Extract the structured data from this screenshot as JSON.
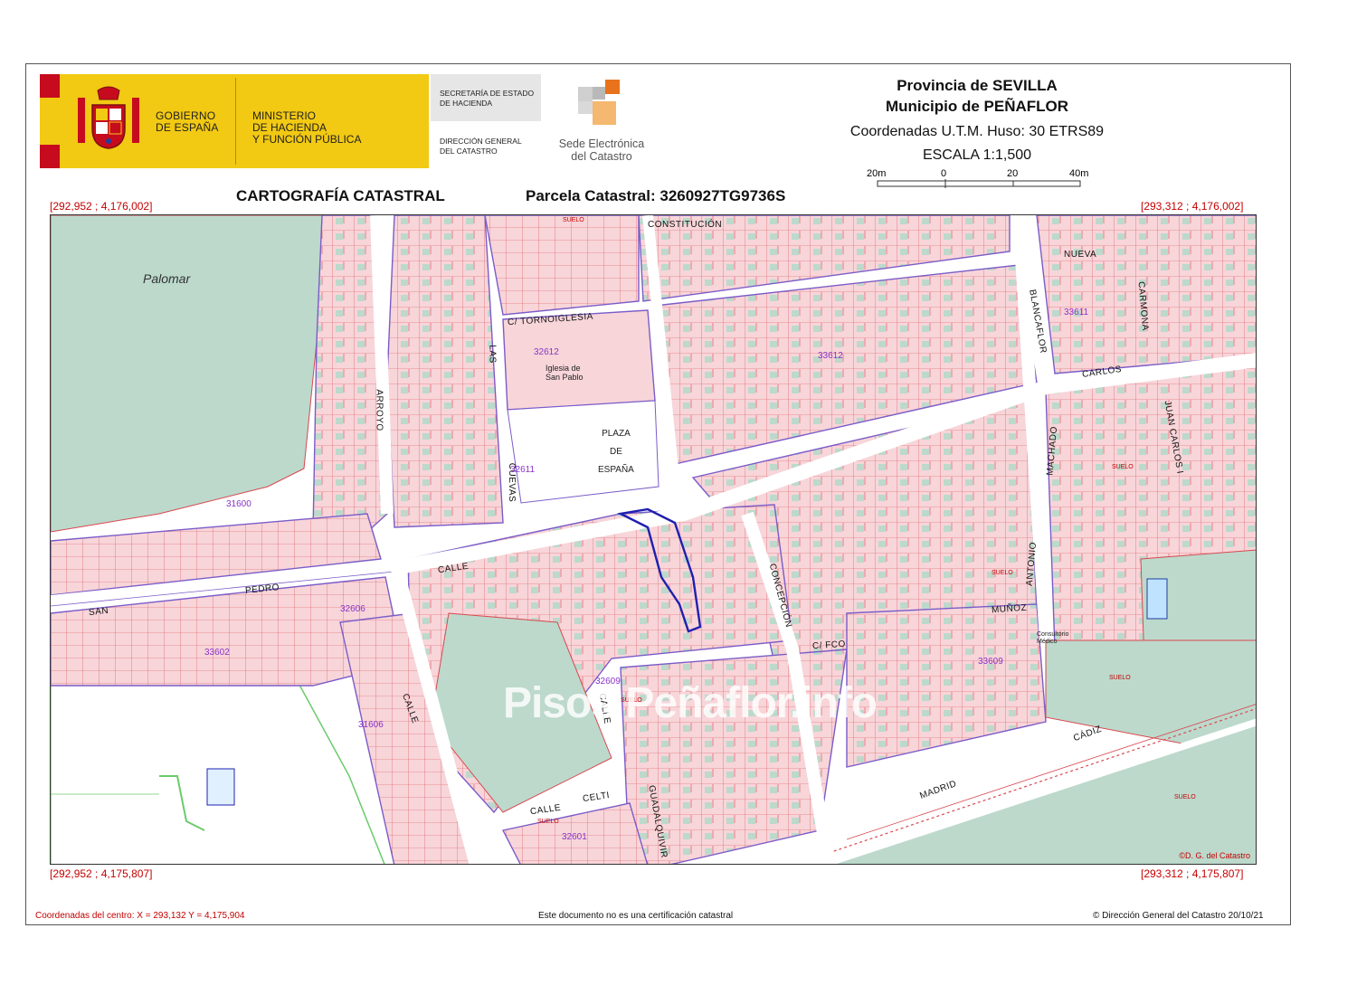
{
  "header": {
    "gobierno_line1": "GOBIERNO",
    "gobierno_line2": "DE ESPAÑA",
    "ministerio_line1": "MINISTERIO",
    "ministerio_line2": "DE HACIENDA",
    "ministerio_line3": "Y FUNCIÓN PÚBLICA",
    "secretaria_line1": "SECRETARÍA DE ESTADO",
    "secretaria_line2": "DE HACIENDA",
    "direccion_line1": "DIRECCIÓN GENERAL",
    "direccion_line2": "DEL CATASTRO",
    "sede_line1": "Sede Electrónica",
    "sede_line2": "del Catastro",
    "provincia": "Provincia de SEVILLA",
    "municipio": "Municipio de PEÑAFLOR",
    "coordenadas": "Coordenadas U.T.M. Huso: 30 ETRS89",
    "escala": "ESCALA 1:1,500",
    "scale_labels": [
      "20m",
      "0",
      "20",
      "40m"
    ]
  },
  "titles": {
    "main": "CARTOGRAFÍA CATASTRAL",
    "parcela": "Parcela Catastral: 3260927TG9736S"
  },
  "corners": {
    "top_left": "[292,952 ; 4,176,002]",
    "top_right": "[293,312 ; 4,176,002]",
    "bottom_left": "[292,952 ; 4,175,807]",
    "bottom_right": "[293,312 ; 4,175,807]"
  },
  "map": {
    "place_label": "Palomar",
    "church_name": "Iglesia de",
    "church_name2": "San Pablo",
    "plaza": [
      "PLAZA",
      "DE",
      "ESPAÑA"
    ],
    "watermark": "Pisos Peñaflor.info",
    "streets": [
      "CONSTITUCIÓN",
      "C/ TORNOIGLESIA",
      "CALLE",
      "CALLE",
      "SAN",
      "PEDRO",
      "CUEVAS",
      "ARROYO",
      "CONCEPCIÓN",
      "C/  FCO",
      "MUÑOZ",
      "CALLE",
      "CELTI",
      "CALLE",
      "GUADALQUIVIR",
      "MADRID",
      "CÁDIZ",
      "NUEVA",
      "CARMONA",
      "BLANCAFLOR",
      "CARLOS",
      "JUAN CARLOS I",
      "ANTONIO",
      "MACHADO",
      "LAS"
    ],
    "blocks": [
      "32612",
      "33612",
      "32611",
      "32609",
      "33609",
      "33611",
      "32606",
      "31606",
      "33602",
      "32601",
      "31600"
    ],
    "consultorio": [
      "Consultorio",
      "Médico"
    ],
    "suelo": "SUELO",
    "copyright": "©D. G. del Catastro"
  },
  "footer": {
    "centro": "Coordenadas del centro: X = 293,132 Y = 4,175,904",
    "aviso": "Este documento no es una certificación catastral",
    "copyright": "© Dirección General del Catastro 20/10/21"
  },
  "colors": {
    "parcel_pink": "#f7d5d9",
    "parcel_green": "#bcd9cc",
    "road": "#ffffff",
    "block_line": "#7b5cc8",
    "parcel_line": "#d9484f",
    "park": "#a6d6a6",
    "selected_parcel": "#1f1fb0"
  }
}
